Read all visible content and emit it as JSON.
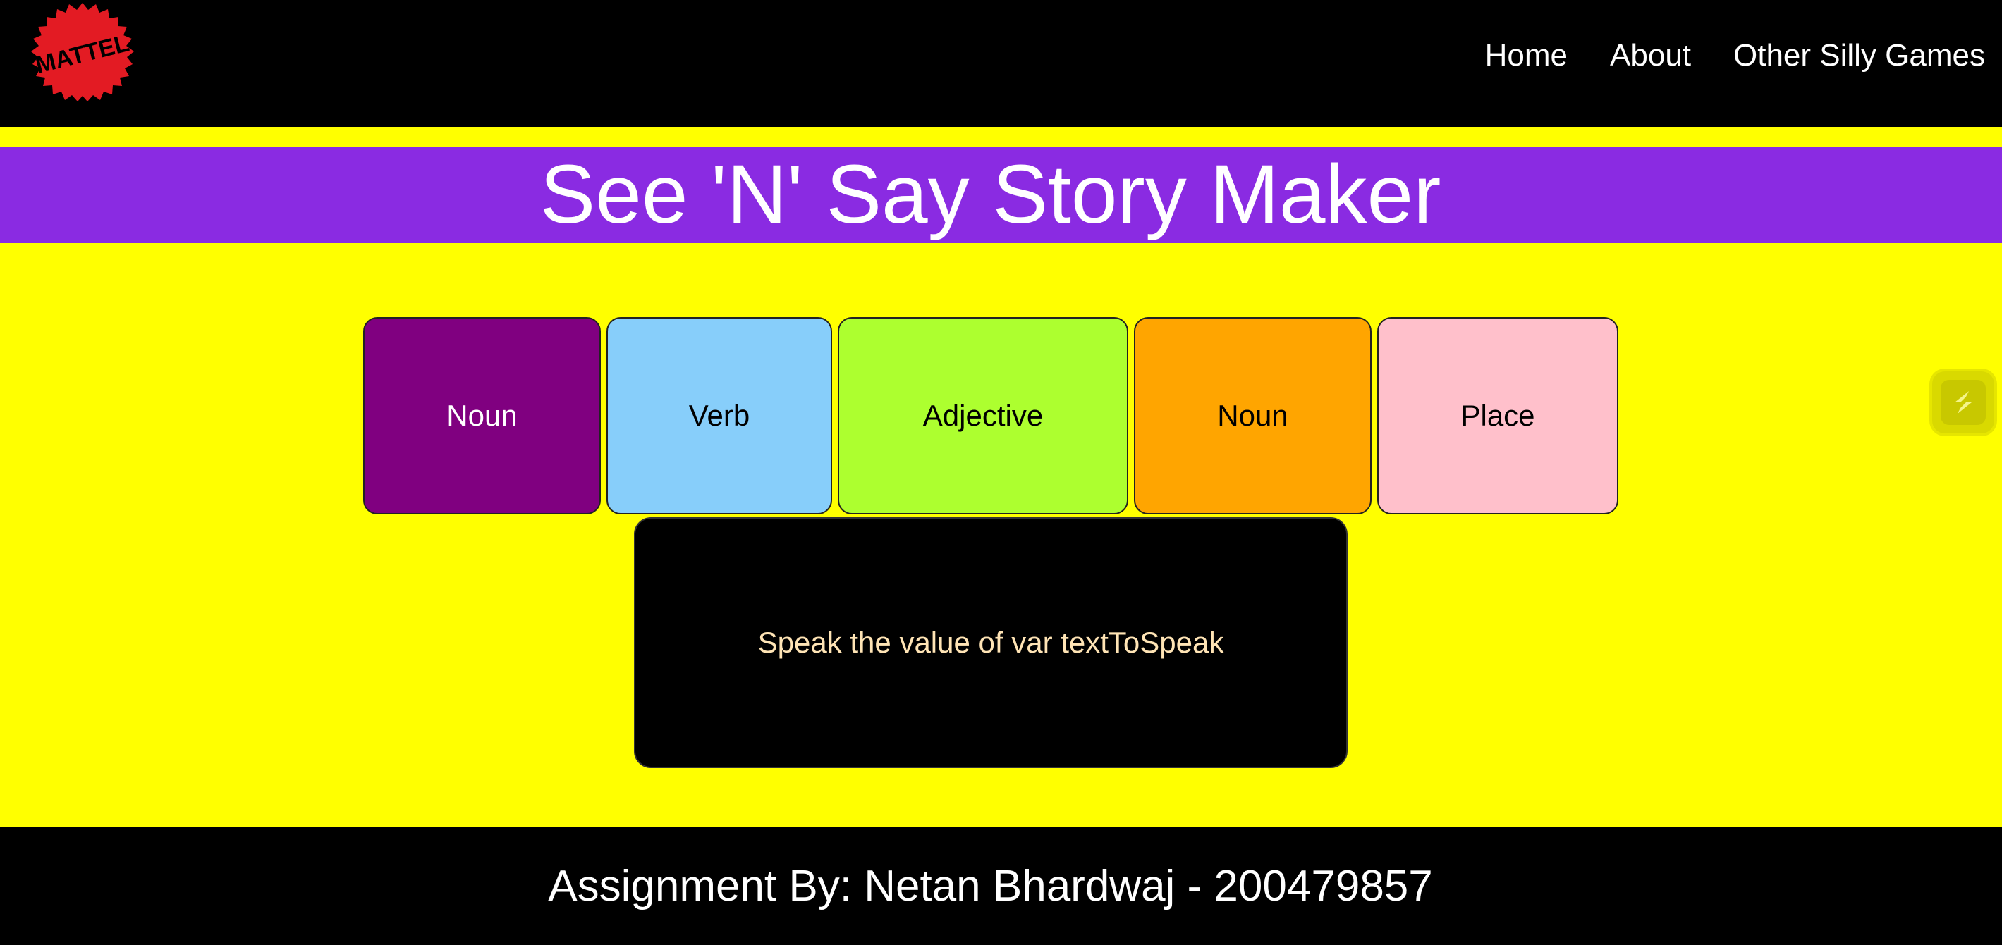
{
  "header": {
    "logo_text": "MATTEL",
    "nav": [
      "Home",
      "About",
      "Other Silly Games"
    ]
  },
  "title": "See 'N' Say Story Maker",
  "buttons": [
    {
      "label": "Noun",
      "bg": "#800080",
      "color": "#ffffff"
    },
    {
      "label": "Verb",
      "bg": "#87cefa",
      "color": "#000000"
    },
    {
      "label": "Adjective",
      "bg": "#adff2f",
      "color": "#000000"
    },
    {
      "label": "Noun",
      "bg": "#ffa500",
      "color": "#000000"
    },
    {
      "label": "Place",
      "bg": "#ffc0cb",
      "color": "#000000"
    }
  ],
  "speak": {
    "label": "Speak the value of var textToSpeak",
    "color": "#ffe4b5"
  },
  "footer": "Assignment By: Netan Bhardwaj - 200479857",
  "colors": {
    "page_bg": "#ffff00",
    "title_bg": "#8a2be2",
    "bar_bg": "#000000",
    "logo": "#e31b23"
  },
  "side_widget_icon": "bolt-icon"
}
